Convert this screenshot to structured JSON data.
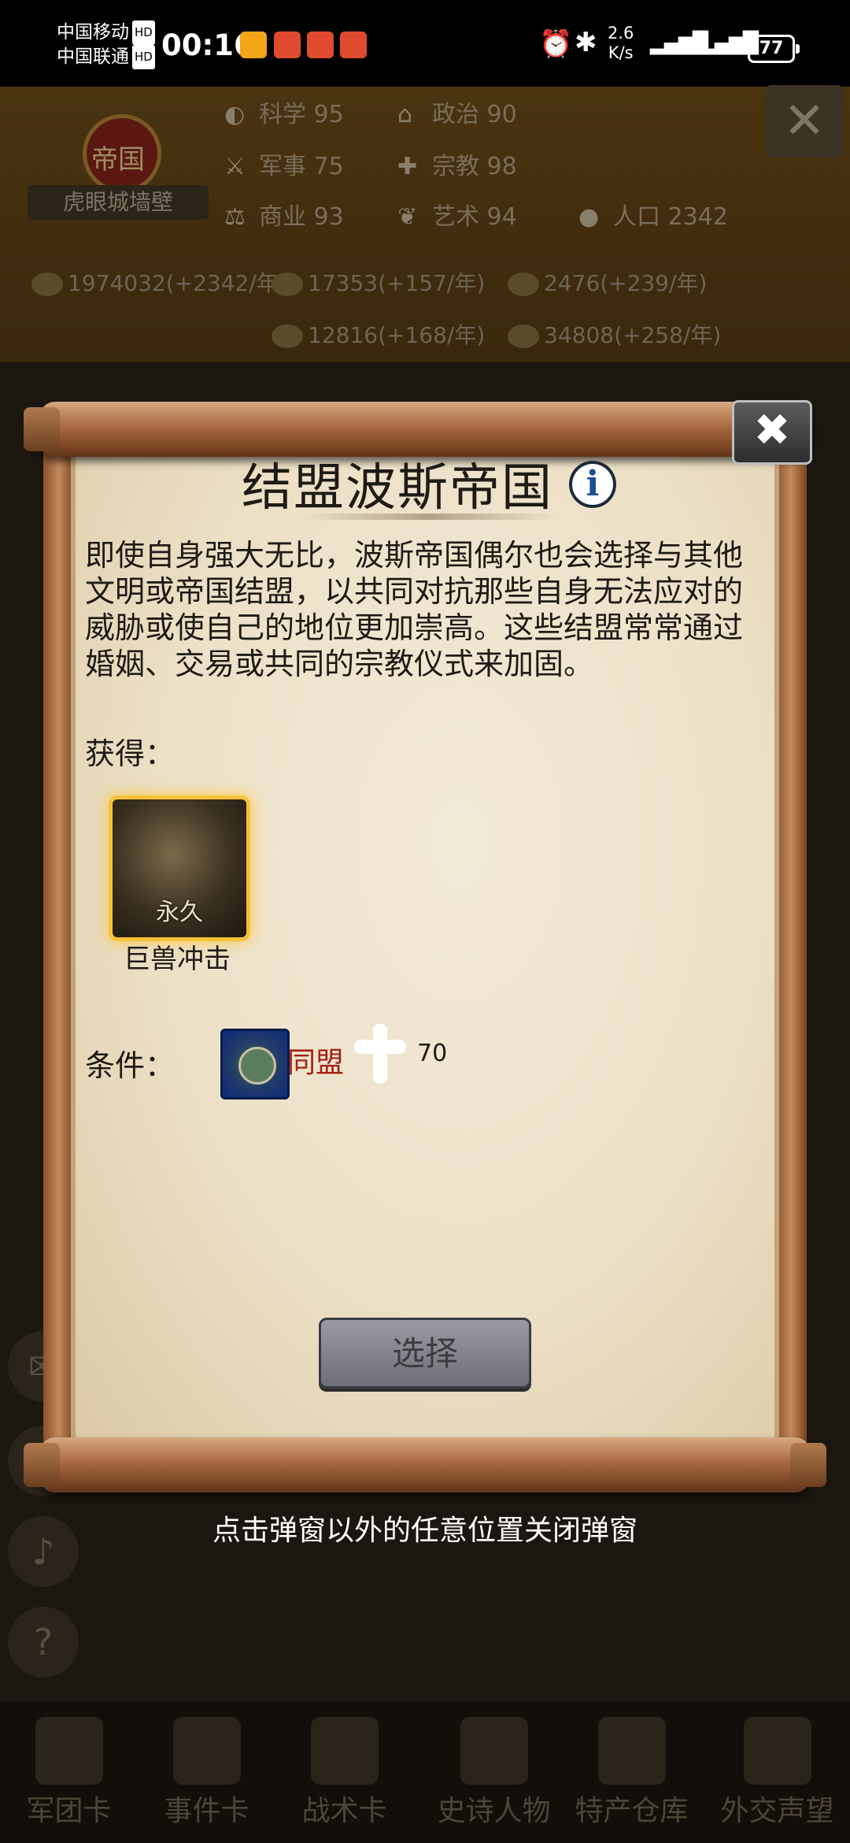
{
  "status_bar": {
    "carrier1": "中国移动",
    "carrier2": "中国联通",
    "hd": "HD",
    "time": "00:16",
    "speed": "2.6\nK/s",
    "battery": "77"
  },
  "header": {
    "empire_title": "帝国",
    "wall_name": "虎眼城墙壁",
    "stats": [
      {
        "icon": "science-icon",
        "label": "科学",
        "value": "95"
      },
      {
        "icon": "politics-icon",
        "label": "政治",
        "value": "90"
      },
      {
        "icon": "military-icon",
        "label": "军事",
        "value": "75"
      },
      {
        "icon": "religion-icon",
        "label": "宗教",
        "value": "98"
      },
      {
        "icon": "commerce-icon",
        "label": "商业",
        "value": "93"
      },
      {
        "icon": "art-icon",
        "label": "艺术",
        "value": "94"
      },
      {
        "icon": "population-icon",
        "label": "人口",
        "value": "2342"
      }
    ],
    "resources": [
      "1974032(+2342/年)",
      "17353(+157/年)",
      "2476(+239/年)",
      "12816(+168/年)",
      "34808(+258/年)"
    ]
  },
  "modal": {
    "title": "结盟波斯帝国",
    "description": "即使自身强大无比，波斯帝国偶尔也会选择与其他文明或帝国结盟，以共同对抗那些自身无法应对的威胁或使自己的地位更加崇高。这些结盟常常通过婚姻、交易或共同的宗教仪式来加固。",
    "gain_label": "获得：",
    "reward_tag": "永久",
    "reward_name": "巨兽冲击",
    "condition_label": "条件：",
    "condition_text": "同盟",
    "condition_value": "70",
    "select_label": "选择",
    "close_symbol": "✖"
  },
  "hint": "点击弹窗以外的任意位置关闭弹窗",
  "bottom_nav": [
    "军团卡",
    "事件卡",
    "战术卡",
    "史诗人物",
    "特产仓库",
    "外交声望"
  ]
}
